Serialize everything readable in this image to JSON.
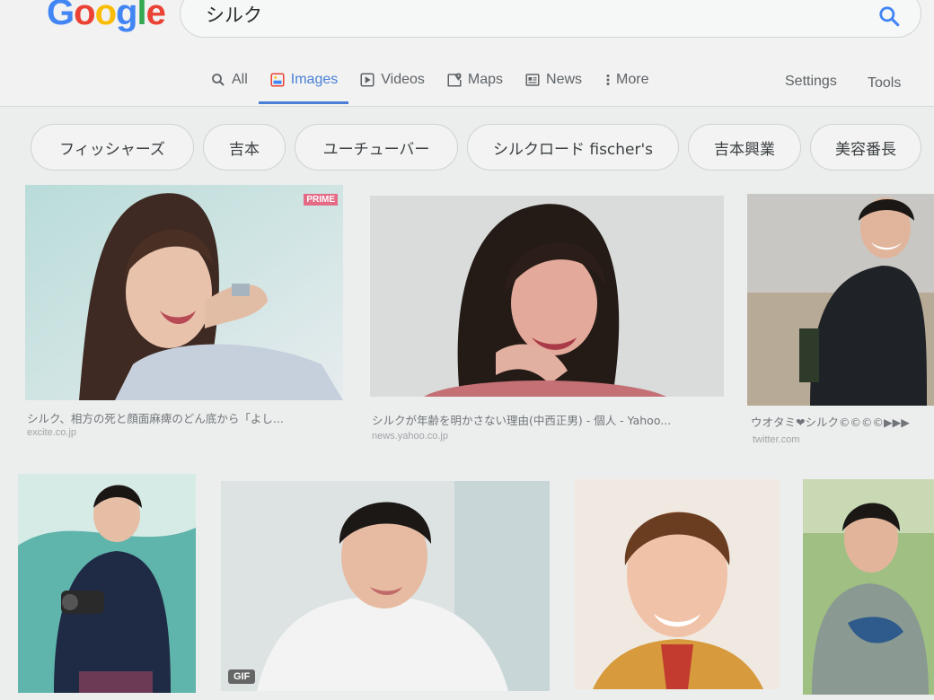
{
  "logo": {
    "text": "Google"
  },
  "search": {
    "query": "シルク"
  },
  "tabs": [
    {
      "label": "All",
      "icon": "search-icon"
    },
    {
      "label": "Images",
      "icon": "image-icon",
      "active": true
    },
    {
      "label": "Videos",
      "icon": "play-icon"
    },
    {
      "label": "Maps",
      "icon": "map-pin-icon"
    },
    {
      "label": "News",
      "icon": "news-icon"
    },
    {
      "label": "More",
      "icon": "more-vert-icon"
    }
  ],
  "toolbar": {
    "settings_label": "Settings",
    "tools_label": "Tools"
  },
  "chips": [
    "フィッシャーズ",
    "吉本",
    "ユーチューバー",
    "シルクロード fischer's",
    "吉本興業",
    "美容番長"
  ],
  "results": [
    {
      "caption": "シルク、相方の死と顔面麻痺のどん底から「よし...",
      "source": "excite.co.jp",
      "badge": "PRIME"
    },
    {
      "caption": "シルクが年齢を明かさない理由(中西正男) - 個人 - Yahoo...",
      "source": "news.yahoo.co.jp"
    },
    {
      "caption": "ウオタミ❤シルク©©©©▶▶▶",
      "source": "twitter.com"
    },
    {
      "caption": "",
      "source": ""
    },
    {
      "caption": "",
      "source": "",
      "badge": "GIF"
    },
    {
      "caption": "",
      "source": ""
    },
    {
      "caption": "",
      "source": ""
    }
  ],
  "colors": {
    "accent": "#4a7fd8",
    "google_blue": "#4285f4",
    "google_red": "#ea4335",
    "google_yellow": "#fbbc05",
    "google_green": "#34a853"
  }
}
